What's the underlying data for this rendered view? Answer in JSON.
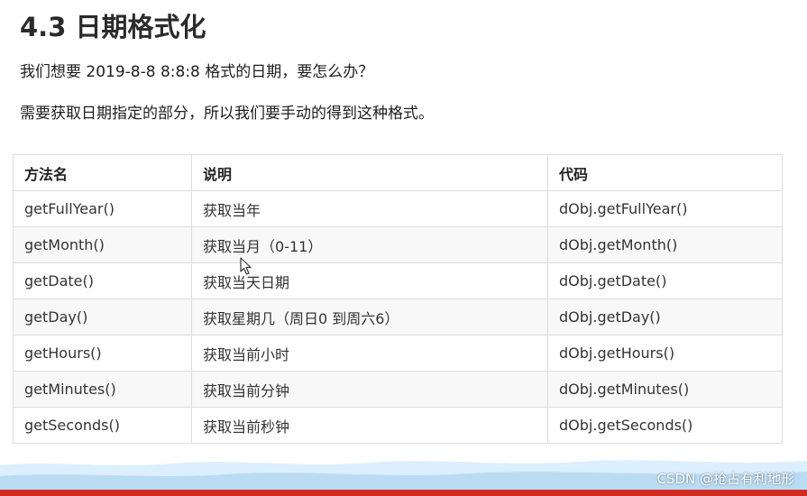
{
  "heading": "4.3 日期格式化",
  "paragraphs": [
    "我们想要 2019-8-8  8:8:8 格式的日期，要怎么办？",
    "需要获取日期指定的部分，所以我们要手动的得到这种格式。"
  ],
  "table": {
    "headers": [
      "方法名",
      "说明",
      "代码"
    ],
    "rows": [
      [
        "getFullYear()",
        "获取当年",
        "dObj.getFullYear()"
      ],
      [
        "getMonth()",
        "获取当月（0-11）",
        "dObj.getMonth()"
      ],
      [
        "getDate()",
        "获取当天日期",
        "dObj.getDate()"
      ],
      [
        "getDay()",
        "获取星期几（周日0 到周六6）",
        "dObj.getDay()"
      ],
      [
        "getHours()",
        "获取当前小时",
        "dObj.getHours()"
      ],
      [
        "getMinutes()",
        "获取当前分钟",
        "dObj.getMinutes()"
      ],
      [
        "getSeconds()",
        "获取当前秒钟",
        "dObj.getSeconds()"
      ]
    ]
  },
  "watermark": "CSDN @抢占有利地形",
  "colors": {
    "footer_bar": "#d22c22",
    "footer_band": "#dcefff",
    "row_alt": "#f8f8f8"
  },
  "cursor": "arrow-cursor-icon"
}
